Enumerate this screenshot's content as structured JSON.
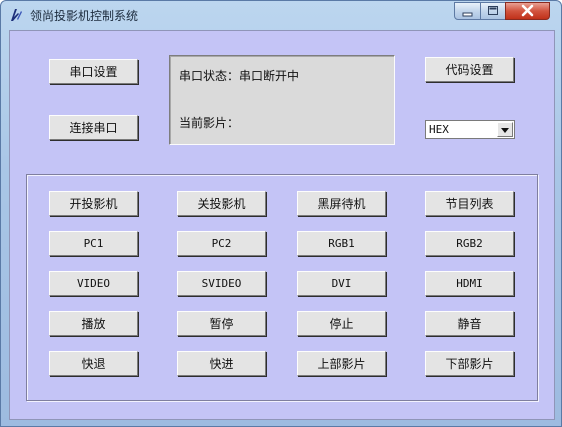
{
  "window": {
    "title": "领尚投影机控制系统"
  },
  "top_buttons": {
    "serial_settings": "串口设置",
    "connect_serial": "连接串口",
    "code_settings": "代码设置"
  },
  "status": {
    "serial_status": "串口状态：串口断开中",
    "current_film": "当前影片："
  },
  "code_format": {
    "selected": "HEX"
  },
  "controls": {
    "row1": [
      "开投影机",
      "关投影机",
      "黑屏待机",
      "节目列表"
    ],
    "row2": [
      "PC1",
      "PC2",
      "RGB1",
      "RGB2"
    ],
    "row3": [
      "VIDEO",
      "SVIDEO",
      "DVI",
      "HDMI"
    ],
    "row4": [
      "播放",
      "暂停",
      "停止",
      "静音"
    ],
    "row5": [
      "快退",
      "快进",
      "上部影片",
      "下部影片"
    ]
  },
  "colors": {
    "client_bg": "#c4c4f6",
    "button_face": "#e4e4e4",
    "status_bg": "#dadada"
  }
}
